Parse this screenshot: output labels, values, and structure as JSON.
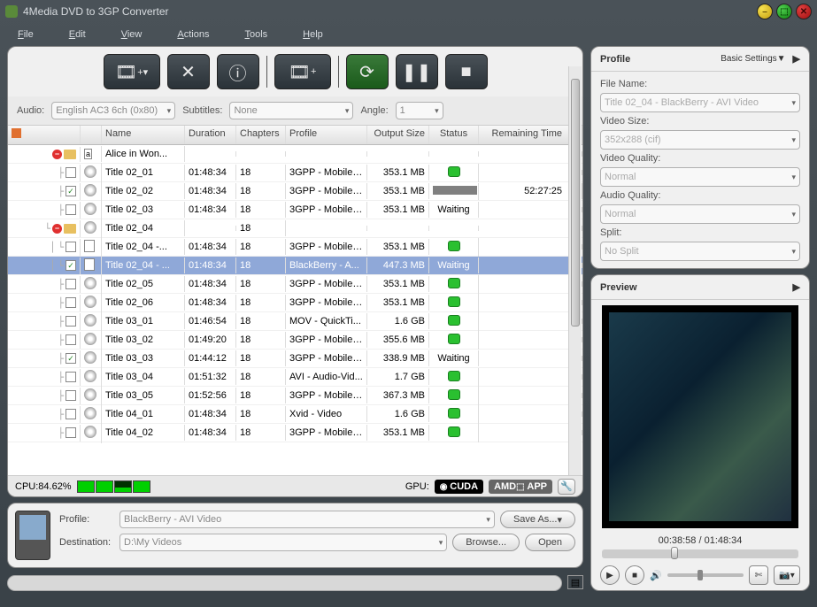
{
  "app": {
    "title": "4Media DVD to 3GP Converter"
  },
  "menu": {
    "file": "File",
    "edit": "Edit",
    "view": "View",
    "actions": "Actions",
    "tools": "Tools",
    "help": "Help"
  },
  "filters": {
    "audioLabel": "Audio:",
    "audioValue": "English AC3 6ch (0x80)",
    "subtitlesLabel": "Subtitles:",
    "subtitlesValue": "None",
    "angleLabel": "Angle:",
    "angleValue": "1"
  },
  "columns": {
    "name": "Name",
    "duration": "Duration",
    "chapters": "Chapters",
    "profile": "Profile",
    "outputSize": "Output Size",
    "status": "Status",
    "remaining": "Remaining Time"
  },
  "rows": [
    {
      "tree": "root",
      "icon": "letter",
      "name": "Alice in Won...",
      "dur": "",
      "chap": "",
      "prof": "",
      "out": "",
      "stat": "",
      "rem": "",
      "checked": false
    },
    {
      "tree": "l1",
      "icon": "disc",
      "name": "Title 02_01",
      "dur": "01:48:34",
      "chap": "18",
      "prof": "3GPP - Mobile ...",
      "out": "353.1 MB",
      "stat": "dot",
      "rem": "",
      "checked": false
    },
    {
      "tree": "l1",
      "icon": "disc",
      "name": "Title 02_02",
      "dur": "01:48:34",
      "chap": "18",
      "prof": "3GPP - Mobile ...",
      "out": "353.1 MB",
      "stat": "bar",
      "rem": "52:27:25",
      "checked": true
    },
    {
      "tree": "l1",
      "icon": "disc",
      "name": "Title 02_03",
      "dur": "01:48:34",
      "chap": "18",
      "prof": "3GPP - Mobile ...",
      "out": "353.1 MB",
      "stat": "Waiting",
      "rem": "",
      "checked": false
    },
    {
      "tree": "folder",
      "icon": "disc",
      "name": "Title 02_04",
      "dur": "",
      "chap": "18",
      "prof": "",
      "out": "",
      "stat": "",
      "rem": "",
      "checked": false
    },
    {
      "tree": "l2",
      "icon": "doc",
      "name": "Title 02_04 -...",
      "dur": "01:48:34",
      "chap": "18",
      "prof": "3GPP - Mobile ...",
      "out": "353.1 MB",
      "stat": "dot",
      "rem": "",
      "checked": false
    },
    {
      "tree": "l2sel",
      "icon": "doc",
      "name": "Title 02_04 - ...",
      "dur": "01:48:34",
      "chap": "18",
      "prof": "BlackBerry - A...",
      "out": "447.3 MB",
      "stat": "Waiting",
      "rem": "",
      "checked": true,
      "selected": true
    },
    {
      "tree": "l1",
      "icon": "disc",
      "name": "Title 02_05",
      "dur": "01:48:34",
      "chap": "18",
      "prof": "3GPP - Mobile ...",
      "out": "353.1 MB",
      "stat": "dot",
      "rem": "",
      "checked": false
    },
    {
      "tree": "l1",
      "icon": "disc",
      "name": "Title 02_06",
      "dur": "01:48:34",
      "chap": "18",
      "prof": "3GPP - Mobile ...",
      "out": "353.1 MB",
      "stat": "dot",
      "rem": "",
      "checked": false
    },
    {
      "tree": "l1",
      "icon": "disc",
      "name": "Title 03_01",
      "dur": "01:46:54",
      "chap": "18",
      "prof": "MOV - QuickTi...",
      "out": "1.6 GB",
      "stat": "dot",
      "rem": "",
      "checked": false
    },
    {
      "tree": "l1",
      "icon": "disc",
      "name": "Title 03_02",
      "dur": "01:49:20",
      "chap": "18",
      "prof": "3GPP - Mobile ...",
      "out": "355.6 MB",
      "stat": "dot",
      "rem": "",
      "checked": false
    },
    {
      "tree": "l1",
      "icon": "disc",
      "name": "Title 03_03",
      "dur": "01:44:12",
      "chap": "18",
      "prof": "3GPP - Mobile ...",
      "out": "338.9 MB",
      "stat": "Waiting",
      "rem": "",
      "checked": true
    },
    {
      "tree": "l1",
      "icon": "disc",
      "name": "Title 03_04",
      "dur": "01:51:32",
      "chap": "18",
      "prof": "AVI - Audio-Vid...",
      "out": "1.7 GB",
      "stat": "dot",
      "rem": "",
      "checked": false
    },
    {
      "tree": "l1",
      "icon": "disc",
      "name": "Title 03_05",
      "dur": "01:52:56",
      "chap": "18",
      "prof": "3GPP - Mobile ...",
      "out": "367.3 MB",
      "stat": "dot",
      "rem": "",
      "checked": false
    },
    {
      "tree": "l1",
      "icon": "disc",
      "name": "Title 04_01",
      "dur": "01:48:34",
      "chap": "18",
      "prof": "Xvid - Video",
      "out": "1.6 GB",
      "stat": "dot",
      "rem": "",
      "checked": false
    },
    {
      "tree": "l1",
      "icon": "disc",
      "name": "Title 04_02",
      "dur": "01:48:34",
      "chap": "18",
      "prof": "3GPP - Mobile ...",
      "out": "353.1 MB",
      "stat": "dot",
      "rem": "",
      "checked": false
    }
  ],
  "cpu": {
    "label": "CPU:84.62%",
    "gpuLabel": "GPU:",
    "cuda": "CUDA",
    "amd": "AMD",
    "app": "APP"
  },
  "bottom": {
    "profileLabel": "Profile:",
    "profileValue": "BlackBerry - AVI Video",
    "saveAs": "Save As...",
    "destLabel": "Destination:",
    "destValue": "D:\\My Videos",
    "browse": "Browse...",
    "open": "Open"
  },
  "profile": {
    "header": "Profile",
    "toggle": "Basic Settings▼",
    "fileNameLabel": "File Name:",
    "fileNameValue": "Title 02_04 - BlackBerry - AVI Video",
    "videoSizeLabel": "Video Size:",
    "videoSizeValue": "352x288 (cif)",
    "videoQualityLabel": "Video Quality:",
    "videoQualityValue": "Normal",
    "audioQualityLabel": "Audio Quality:",
    "audioQualityValue": "Normal",
    "splitLabel": "Split:",
    "splitValue": "No Split"
  },
  "preview": {
    "header": "Preview",
    "time": "00:38:58 / 01:48:34"
  }
}
